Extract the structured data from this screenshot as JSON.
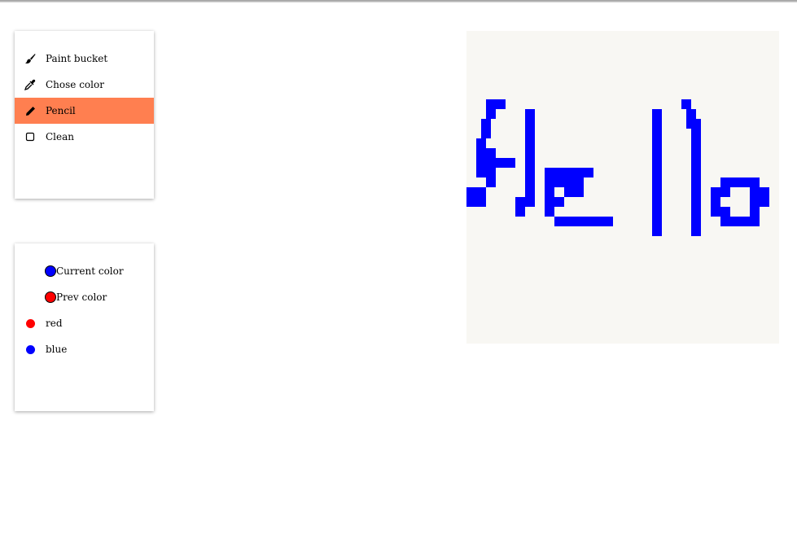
{
  "tools": {
    "items": [
      {
        "label": "Paint bucket",
        "icon": "brush-icon",
        "active": false
      },
      {
        "label": "Chose color",
        "icon": "eyedropper-icon",
        "active": false
      },
      {
        "label": "Pencil",
        "icon": "pencil-icon",
        "active": true
      },
      {
        "label": "Clean",
        "icon": "square-icon",
        "active": false
      }
    ],
    "active_color": "#ff7f50"
  },
  "colors": {
    "current": {
      "label": "Current color",
      "value": "#0000ff"
    },
    "previous": {
      "label": "Prev color",
      "value": "#ff0000"
    },
    "palette": [
      {
        "label": "red",
        "value": "#ff0000"
      },
      {
        "label": "blue",
        "value": "#0000ff"
      }
    ]
  },
  "canvas": {
    "background": "#f8f7f3",
    "ink": "#0000ff"
  }
}
